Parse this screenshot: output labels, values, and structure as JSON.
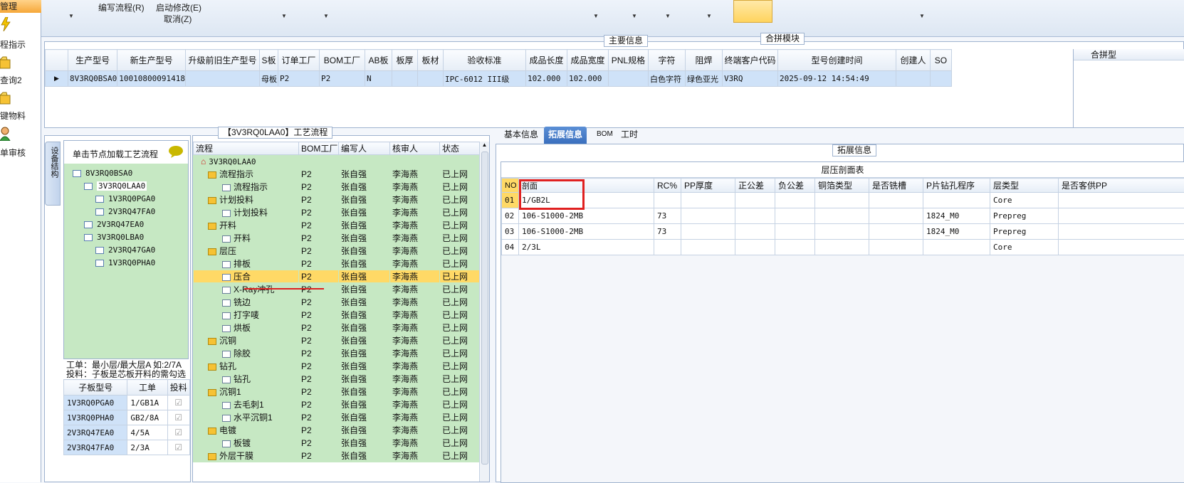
{
  "leftnav": {
    "header": "管理",
    "items": [
      "程指示",
      "查询2",
      "键物料",
      "单审核"
    ]
  },
  "toolbar": {
    "edit_flow": "编写流程(R)",
    "start_modify": "启动修改(E)",
    "cancel": "取消(Z)",
    "merge_module": "合拼模块"
  },
  "main_info": {
    "title": "主要信息",
    "right_title": "合拼型",
    "columns": [
      "生产型号",
      "新生产型号",
      "升级前旧生产型号",
      "S板",
      "订单工厂",
      "BOM工厂",
      "AB板",
      "板厚",
      "板材",
      "验收标准",
      "成品长度",
      "成品宽度",
      "PNL规格",
      "字符",
      "阻焊",
      "终端客户代码",
      "型号创建时间",
      "创建人",
      "SO"
    ],
    "row": [
      "8V3RQ0BSA0",
      "10010800091418",
      "",
      "母板",
      "P2",
      "P2",
      "N",
      "",
      "",
      "IPC-6012 III级",
      "102.000",
      "102.000",
      "",
      "白色字符",
      "绿色亚光",
      "V3RQ",
      "2025-09-12 14:54:49",
      "",
      ""
    ]
  },
  "tree_panel": {
    "side_tab": "设备结构",
    "hint": "单击节点加载工艺流程",
    "nodes": [
      "8V3RQ0BSA0",
      "3V3RQ0LAA0",
      "1V3RQ0PGA0",
      "2V3RQ47FA0",
      "2V3RQ47EA0",
      "3V3RQ0LBA0",
      "2V3RQ47GA0",
      "1V3RQ0PHA0"
    ],
    "note1": "工单：最小层/最大层A 如:2/7A",
    "note2": "投料：子板是芯板开料的需勾选",
    "sub_headers": [
      "子板型号",
      "工单",
      "投料"
    ],
    "sub_rows": [
      [
        "1V3RQ0PGA0",
        "1/GB1A"
      ],
      [
        "1V3RQ0PHA0",
        "GB2/8A"
      ],
      [
        "2V3RQ47EA0",
        "4/5A"
      ],
      [
        "2V3RQ47FA0",
        "2/3A"
      ]
    ]
  },
  "flow_panel": {
    "title": "【3V3RQ0LAA0】工艺流程",
    "headers": [
      "流程",
      "BOM工厂",
      "编写人",
      "核审人",
      "状态"
    ],
    "root": "3V3RQ0LAA0",
    "rows": [
      {
        "name": "流程指示",
        "level": 1,
        "folder": true
      },
      {
        "name": "流程指示",
        "level": 2
      },
      {
        "name": "计划投料",
        "level": 1,
        "folder": true
      },
      {
        "name": "计划投料",
        "level": 2
      },
      {
        "name": "开料",
        "level": 1,
        "folder": true
      },
      {
        "name": "开料",
        "level": 2
      },
      {
        "name": "层压",
        "level": 1,
        "folder": true
      },
      {
        "name": "排板",
        "level": 2
      },
      {
        "name": "压合",
        "level": 2,
        "selected": true
      },
      {
        "name": "X-Ray冲孔",
        "level": 2
      },
      {
        "name": "铣边",
        "level": 2
      },
      {
        "name": "打字唛",
        "level": 2
      },
      {
        "name": "烘板",
        "level": 2
      },
      {
        "name": "沉铜",
        "level": 1,
        "folder": true
      },
      {
        "name": "除胶",
        "level": 2
      },
      {
        "name": "钻孔",
        "level": 1,
        "folder": true
      },
      {
        "name": "钻孔",
        "level": 2
      },
      {
        "name": "沉铜1",
        "level": 1,
        "folder": true
      },
      {
        "name": "去毛刺1",
        "level": 2
      },
      {
        "name": "水平沉铜1",
        "level": 2
      },
      {
        "name": "电镀",
        "level": 1,
        "folder": true
      },
      {
        "name": "板镀",
        "level": 2
      },
      {
        "name": "外层干膜",
        "level": 1,
        "folder": true
      }
    ],
    "bom": "P2",
    "writer": "张自强",
    "checker": "李海燕",
    "status": "已上网"
  },
  "right_panel": {
    "tabs": [
      "基本信息",
      "拓展信息",
      "BOM",
      "工时"
    ],
    "section": "拓展信息",
    "table_title": "层压剖面表",
    "headers": [
      "NO",
      "剖面",
      "RC%",
      "PP厚度",
      "正公差",
      "负公差",
      "铜箔类型",
      "是否铣槽",
      "P片钻孔程序",
      "层类型",
      "是否客供PP"
    ],
    "rows": [
      [
        "01",
        "1/GB2L",
        "",
        "",
        "",
        "",
        "",
        "",
        "",
        "Core",
        ""
      ],
      [
        "02",
        "106-S1000-2MB",
        "73",
        "",
        "",
        "",
        "",
        "",
        "1824_M0",
        "Prepreg",
        ""
      ],
      [
        "03",
        "106-S1000-2MB",
        "73",
        "",
        "",
        "",
        "",
        "",
        "1824_M0",
        "Prepreg",
        ""
      ],
      [
        "04",
        "2/3L",
        "",
        "",
        "",
        "",
        "",
        "",
        "",
        "Core",
        ""
      ]
    ]
  },
  "colors": {
    "highlight": "#ffd966",
    "grid_green": "#c6e8c3",
    "selection_blue": "#cfe2f8",
    "annotation_red": "#e02020"
  }
}
